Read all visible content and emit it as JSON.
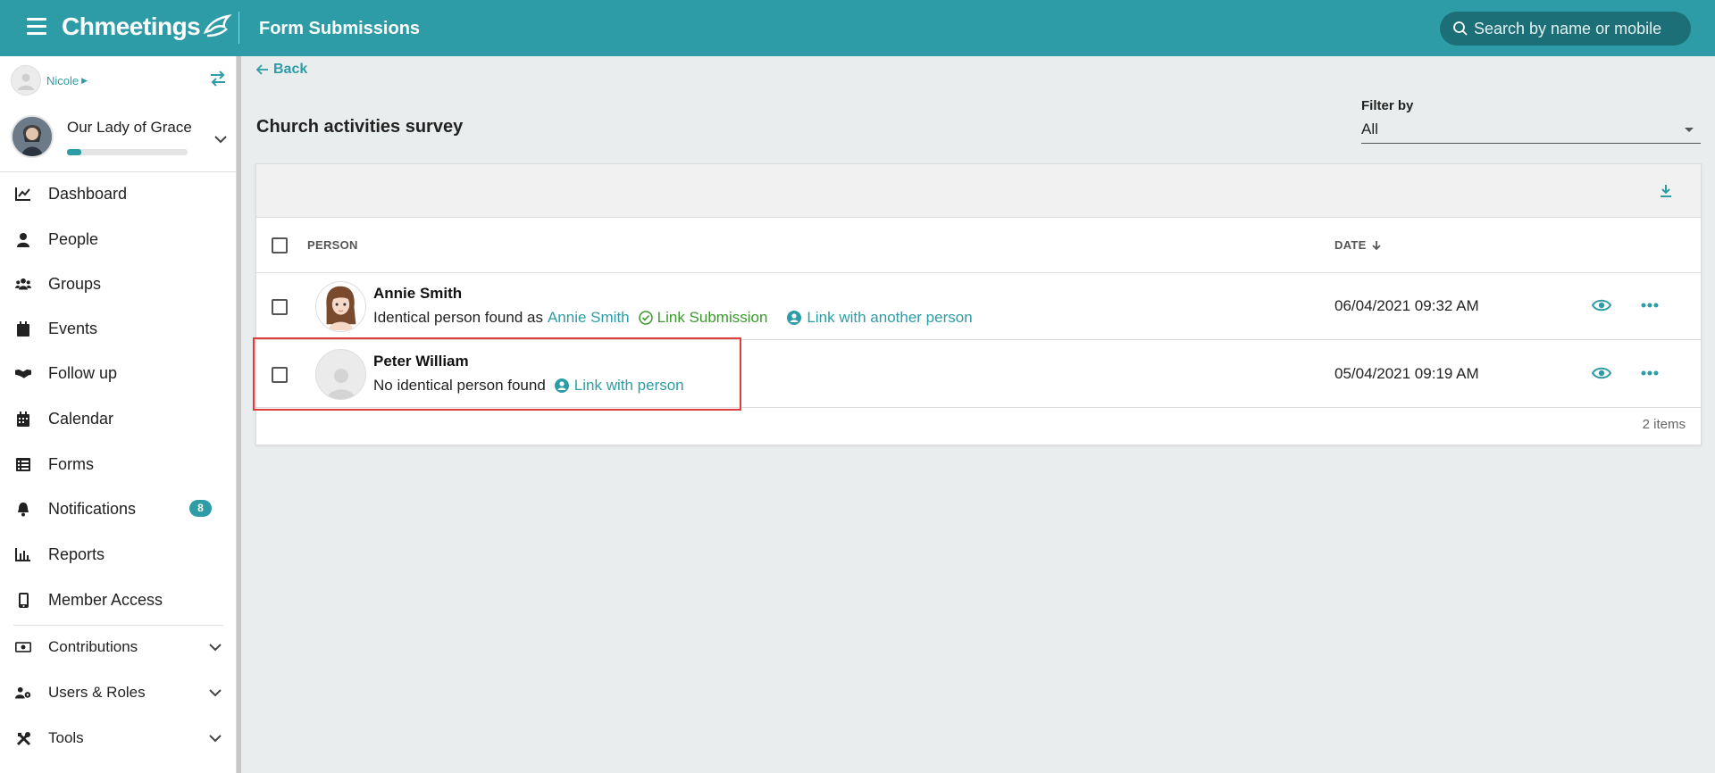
{
  "app": {
    "logo_text": "Chmeetings",
    "page_title": "Form Submissions",
    "brand_color": "#2e9ca6"
  },
  "search": {
    "placeholder": "Search by name or mobile"
  },
  "sidebar": {
    "user_name": "Nicole",
    "church_name": "Our Lady of Grace",
    "church_progress": 0.12,
    "items": [
      {
        "label": "Dashboard",
        "icon": "chart-line-icon"
      },
      {
        "label": "People",
        "icon": "person-icon"
      },
      {
        "label": "Groups",
        "icon": "users-icon"
      },
      {
        "label": "Events",
        "icon": "calendar-block-icon"
      },
      {
        "label": "Follow up",
        "icon": "handshake-icon"
      },
      {
        "label": "Calendar",
        "icon": "calendar-icon"
      },
      {
        "label": "Forms",
        "icon": "list-icon"
      },
      {
        "label": "Notifications",
        "icon": "bell-icon",
        "badge": "8"
      },
      {
        "label": "Reports",
        "icon": "bar-chart-icon"
      },
      {
        "label": "Member Access",
        "icon": "mobile-icon"
      },
      {
        "label": "Contributions",
        "icon": "money-icon"
      },
      {
        "label": "Users & Roles",
        "icon": "users-cog-icon"
      },
      {
        "label": "Tools",
        "icon": "tools-icon"
      }
    ]
  },
  "main": {
    "back_label": "Back",
    "survey_title": "Church activities survey",
    "filter": {
      "label": "Filter by",
      "value": "All"
    },
    "table": {
      "columns": [
        "PERSON",
        "DATE"
      ],
      "rows": [
        {
          "name": "Annie Smith",
          "detail_prefix": "Identical person found as",
          "matched_name": "Annie Smith",
          "link_submission": "Link Submission",
          "link_action": "Link with another person",
          "date": "06/04/2021 09:32 AM"
        },
        {
          "name": "Peter William",
          "detail_prefix": "No identical person found",
          "link_action": "Link with person",
          "date": "05/04/2021 09:19 AM"
        }
      ],
      "items_count": "2 items"
    }
  }
}
